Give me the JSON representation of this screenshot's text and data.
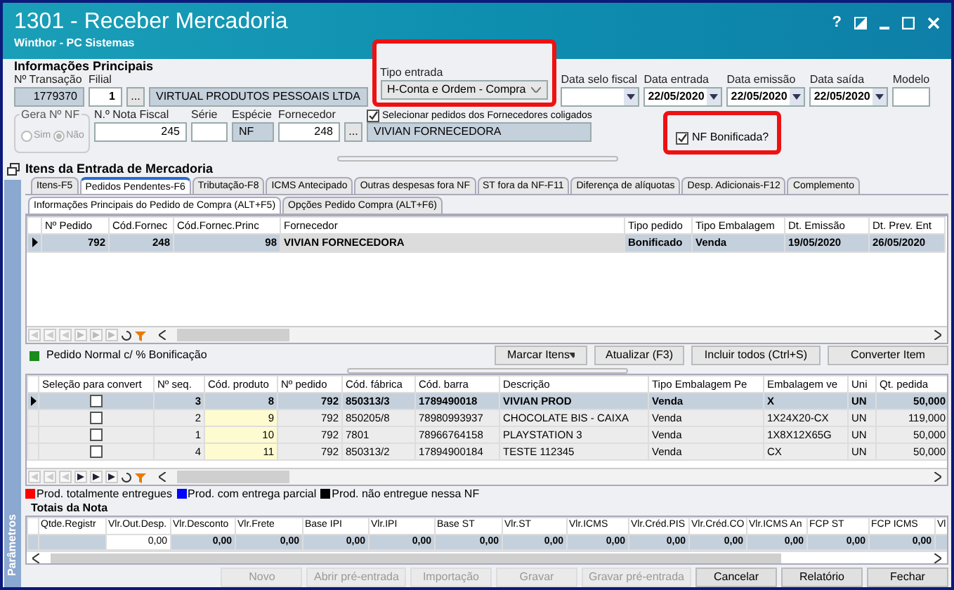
{
  "window": {
    "title": "1301 - Receber Mercadoria",
    "subtitle": "Winthor - PC Sistemas",
    "help": "?"
  },
  "principal": {
    "title": "Informações Principais",
    "transacao": {
      "label": "Nº Transação",
      "value": "1779370"
    },
    "filial": {
      "label": "Filial",
      "value": "1",
      "button": "...",
      "name": "VIRTUAL PRODUTOS PESSOAIS LTDA"
    },
    "tipo_entrada": {
      "label": "Tipo entrada",
      "value": "H-Conta e Ordem - Compra"
    },
    "data_selo": {
      "label": "Data selo fiscal"
    },
    "data_entrada": {
      "label": "Data entrada",
      "value": "22/05/2020"
    },
    "data_emissao": {
      "label": "Data emissão",
      "value": "22/05/2020"
    },
    "data_saida": {
      "label": "Data saída",
      "value": "22/05/2020"
    },
    "modelo": {
      "label": "Modelo"
    },
    "gera_nf": {
      "label": "Gera Nº NF",
      "options": [
        {
          "label": "Sim",
          "selected": false
        },
        {
          "label": "Não",
          "selected": true
        }
      ]
    },
    "nota": {
      "label": "N.º Nota Fiscal",
      "value": "245"
    },
    "serie": {
      "label": "Série"
    },
    "especie": {
      "label": "Espécie",
      "value": "NF"
    },
    "fornecedor": {
      "label": "Fornecedor",
      "value": "248",
      "button": "...",
      "name": "VIVIAN FORNECEDORA"
    },
    "selecionar": {
      "label": "Selecionar pedidos dos Fornecedores coligados",
      "checked": true
    },
    "bonificada": {
      "label": "NF Bonificada?",
      "checked": true
    }
  },
  "itens": {
    "title": "Itens da Entrada de Mercadoria",
    "tabs": [
      {
        "label": "Itens-F5",
        "selected": false
      },
      {
        "label": "Pedidos Pendentes-F6",
        "selected": true
      },
      {
        "label": "Tributação-F8",
        "selected": false
      },
      {
        "label": "ICMS Antecipado",
        "selected": false
      },
      {
        "label": "Outras despesas fora NF",
        "selected": false
      },
      {
        "label": "ST fora da NF-F11",
        "selected": false
      },
      {
        "label": "Diferença de alíquotas",
        "selected": false
      },
      {
        "label": "Desp. Adicionais-F12",
        "selected": false
      },
      {
        "label": "Complemento",
        "selected": false
      }
    ],
    "subtabs": [
      {
        "label": "Informações Principais do Pedido de Compra (ALT+F5)",
        "selected": true
      },
      {
        "label": "Opções Pedido Compra (ALT+F6)",
        "selected": false
      }
    ]
  },
  "pedidos": {
    "nav_enabled": false,
    "columns": [
      "Nº Pedido",
      "Cód.Fornec",
      "Cód.Fornec.Princ",
      "Fornecedor",
      "Tipo pedido",
      "Tipo Embalagem",
      "Dt. Emissão",
      "Dt. Prev. Ent"
    ],
    "rows": [
      {
        "selected": true,
        "cells": [
          "792",
          "248",
          "98",
          "VIVIAN FORNECEDORA",
          "Bonificado",
          "Venda",
          "19/05/2020",
          "26/05/2020"
        ]
      }
    ]
  },
  "legenda_pedido": {
    "label": "Pedido Normal c/ % Bonificação",
    "color": "#1a8a1a"
  },
  "acoes": [
    {
      "label": "Marcar Itens",
      "kind": "dropdown"
    },
    {
      "label": "Atualizar (F3)",
      "kind": "button"
    },
    {
      "label": "Incluir todos (Ctrl+S)",
      "kind": "button"
    },
    {
      "label": "Converter Item",
      "kind": "button"
    }
  ],
  "produtos": {
    "nav_enabled": true,
    "columns": [
      "Seleção para convert",
      "Nº seq.",
      "Cód. produto",
      "Nº pedido",
      "Cód. fábrica",
      "Cód. barra",
      "Descrição",
      "Tipo Embalagem Pe",
      "Embalagem ve",
      "Uni",
      "Qt. pedida"
    ],
    "rows": [
      {
        "selected": true,
        "checked": false,
        "cells": [
          null,
          "3",
          "8",
          "792",
          "850313/3",
          "1789490018",
          "VIVIAN PROD",
          "Venda",
          "X",
          "UN",
          "50,000"
        ]
      },
      {
        "selected": false,
        "checked": false,
        "cells": [
          null,
          "2",
          "9",
          "792",
          "850205/8",
          "78980993937",
          "CHOCOLATE BIS - CAIXA",
          "Venda",
          "1X24X20-CX",
          "UN",
          "119,000"
        ]
      },
      {
        "selected": false,
        "checked": false,
        "cells": [
          null,
          "1",
          "10",
          "792",
          "7801",
          "78966764158",
          "PLAYSTATION 3",
          "Venda",
          "1X8X12X65G",
          "UN",
          "50,000"
        ]
      },
      {
        "selected": false,
        "checked": false,
        "cells": [
          null,
          "4",
          "11",
          "792",
          "850313/2",
          "17894900184",
          "TESTE 112345",
          "Venda",
          "CX",
          "UN",
          "50,000"
        ]
      }
    ]
  },
  "legenda": [
    {
      "label": "Prod. totalmente entregues",
      "color": "#ff0000"
    },
    {
      "label": "Prod. com entrega parcial",
      "color": "#0000ff"
    },
    {
      "label": "Prod. não entregue nessa NF",
      "color": "#000000"
    }
  ],
  "parametros": "Parâmetros",
  "totais": {
    "title": "Totais da Nota",
    "columns": [
      "Qtde.Registr",
      "Vlr.Out.Desp.",
      "Vlr.Desconto",
      "Vlr.Frete",
      "Base IPI",
      "Vlr.IPI",
      "Base ST",
      "Vlr.ST",
      "Vlr.ICMS",
      "Vlr.Créd.PIS",
      "Vlr.Créd.CO",
      "Vlr.ICMS An",
      "FCP ST",
      "FCP ICMS",
      "Vl"
    ],
    "values": [
      "0,00",
      "0,00",
      "0,00",
      "0,00",
      "0,00",
      "0,00",
      "0,00",
      "0,00",
      "0,00",
      "0,00",
      "0,00",
      "0,00",
      "0,00"
    ]
  },
  "buttons": [
    {
      "label": "Novo",
      "disabled": true
    },
    {
      "label": "Abrir pré-entrada",
      "disabled": true
    },
    {
      "label": "Importação",
      "disabled": true
    },
    {
      "label": "Gravar",
      "disabled": true
    },
    {
      "label": "Gravar pré-entrada",
      "disabled": true
    },
    {
      "label": "Cancelar",
      "disabled": false
    },
    {
      "label": "Relatório",
      "disabled": false
    },
    {
      "label": "Fechar",
      "disabled": false
    }
  ]
}
